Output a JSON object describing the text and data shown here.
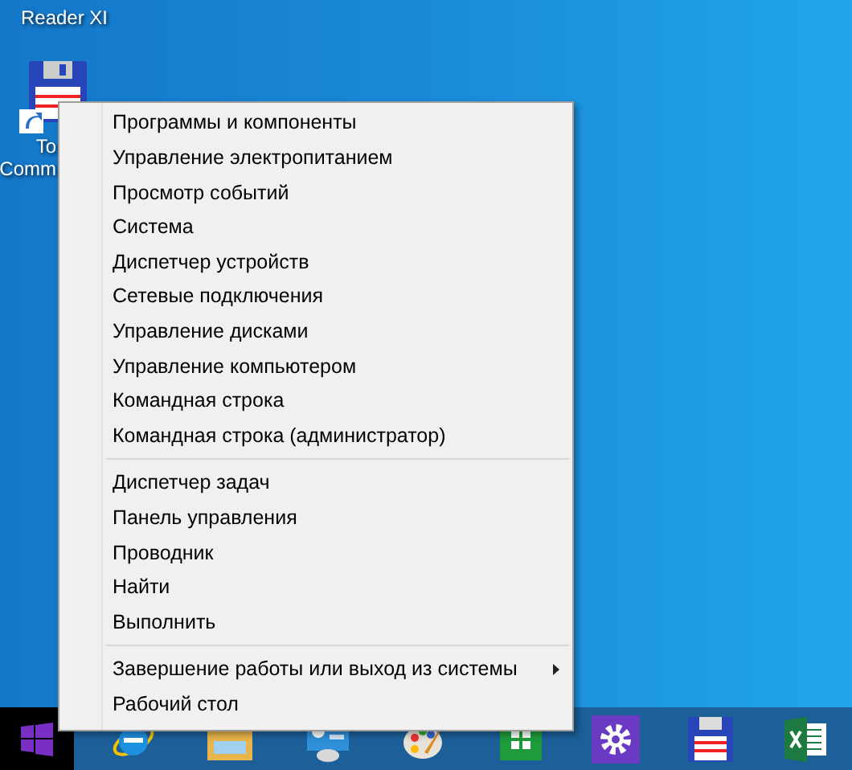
{
  "desktop": {
    "icons": [
      {
        "lines": [
          "Reader XI"
        ],
        "kind": "label"
      },
      {
        "lines": [
          "To",
          "Comm"
        ],
        "kind": "shortcut"
      }
    ]
  },
  "context_menu": {
    "groups": [
      [
        {
          "label": "Программы и компоненты",
          "submenu": false
        },
        {
          "label": "Управление электропитанием",
          "submenu": false
        },
        {
          "label": "Просмотр событий",
          "submenu": false
        },
        {
          "label": "Система",
          "submenu": false
        },
        {
          "label": "Диспетчер устройств",
          "submenu": false
        },
        {
          "label": "Сетевые подключения",
          "submenu": false
        },
        {
          "label": "Управление дисками",
          "submenu": false
        },
        {
          "label": "Управление компьютером",
          "submenu": false
        },
        {
          "label": "Командная строка",
          "submenu": false
        },
        {
          "label": "Командная строка (администратор)",
          "submenu": false
        }
      ],
      [
        {
          "label": "Диспетчер задач",
          "submenu": false
        },
        {
          "label": "Панель управления",
          "submenu": false
        },
        {
          "label": "Проводник",
          "submenu": false
        },
        {
          "label": "Найти",
          "submenu": false
        },
        {
          "label": "Выполнить",
          "submenu": false
        }
      ],
      [
        {
          "label": "Завершение работы или выход из системы",
          "submenu": true
        },
        {
          "label": "Рабочий стол",
          "submenu": false
        }
      ]
    ]
  }
}
